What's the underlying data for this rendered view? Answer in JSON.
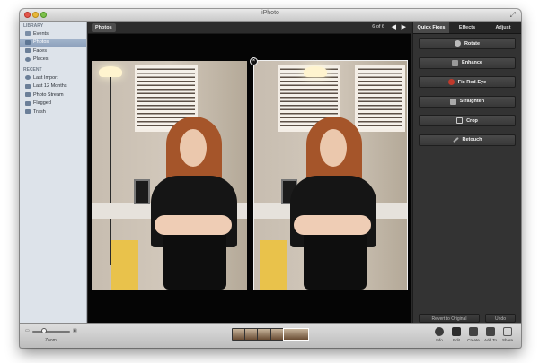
{
  "window": {
    "title": "iPhoto"
  },
  "sidebar": {
    "library_header": "LIBRARY",
    "library_items": [
      {
        "label": "Events",
        "icon": "events-icon"
      },
      {
        "label": "Photos",
        "icon": "photos-icon",
        "selected": true
      },
      {
        "label": "Faces",
        "icon": "faces-icon"
      },
      {
        "label": "Places",
        "icon": "places-icon"
      }
    ],
    "recent_header": "RECENT",
    "recent_items": [
      {
        "label": "Last Import",
        "icon": "import-icon"
      },
      {
        "label": "Last 12 Months",
        "icon": "calendar-icon"
      },
      {
        "label": "Photo Stream",
        "icon": "photo-stream-icon"
      },
      {
        "label": "Flagged",
        "icon": "flag-icon"
      },
      {
        "label": "Trash",
        "icon": "trash-icon"
      }
    ]
  },
  "viewer": {
    "breadcrumb": "Photos",
    "counter": "6 of 6"
  },
  "panel": {
    "tabs": [
      {
        "label": "Quick Fixes",
        "active": true
      },
      {
        "label": "Effects"
      },
      {
        "label": "Adjust"
      }
    ],
    "fixes": [
      {
        "label": "Rotate",
        "icon": "rotate-icon"
      },
      {
        "label": "Enhance",
        "icon": "enhance-wand-icon"
      },
      {
        "label": "Fix Red-Eye",
        "icon": "red-eye-icon"
      },
      {
        "label": "Straighten",
        "icon": "straighten-icon"
      },
      {
        "label": "Crop",
        "icon": "crop-icon"
      },
      {
        "label": "Retouch",
        "icon": "retouch-brush-icon"
      }
    ],
    "revert_label": "Revert to Original",
    "undo_label": "Undo"
  },
  "toolbar": {
    "zoom_label": "Zoom",
    "zoom_level": 0.3,
    "tools": [
      {
        "label": "Info",
        "icon": "info-icon"
      },
      {
        "label": "Edit",
        "icon": "edit-icon",
        "active": true
      },
      {
        "label": "Create",
        "icon": "create-icon"
      },
      {
        "label": "Add To",
        "icon": "add-to-icon"
      },
      {
        "label": "Share",
        "icon": "share-icon"
      }
    ]
  },
  "colors": {
    "sidebar_bg": "#dde3ea",
    "selection": "#8ea2bd",
    "panel_bg": "#333333",
    "viewer_bg": "#050505",
    "red_eye_icon": "#c0392b"
  }
}
